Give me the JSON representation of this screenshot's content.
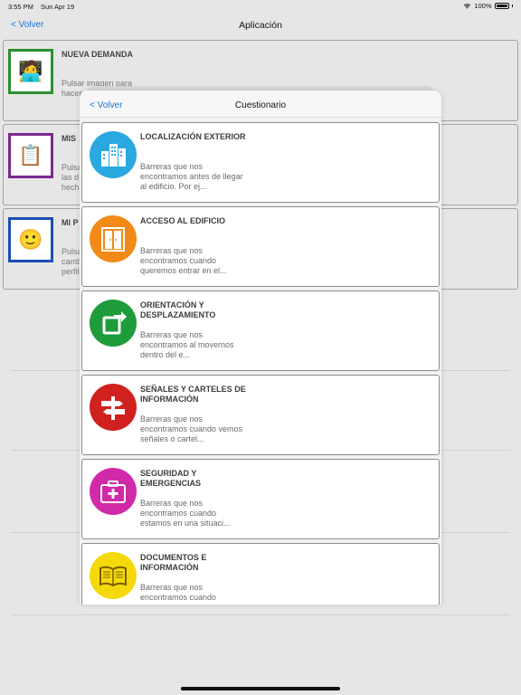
{
  "status_bar": {
    "time": "3:55 PM",
    "date": "Sun Apr 19",
    "battery": "100%"
  },
  "nav": {
    "back_label": "< Volver",
    "title": "Aplicación"
  },
  "background_cards": [
    {
      "title": "NUEVA DEMANDA",
      "desc": "Pulsar imagen para hacer"
    },
    {
      "title": "MIS",
      "desc": "Pulsa las d hech"
    },
    {
      "title": "MI P",
      "desc": "Pulsa camb perfil"
    }
  ],
  "modal": {
    "back_label": "< Volver",
    "title": "Cuestionario",
    "items": [
      {
        "name": "LOCALIZACIÓN EXTERIOR",
        "desc": "Barreras que nos encontramos antes de llegar al edificio. Por ej...",
        "color": "#2aa9e0",
        "icon": "buildings-icon"
      },
      {
        "name": "ACCESO AL EDIFICIO",
        "desc": "Barreras que nos encontramos cuando queremos entrar en el...",
        "color": "#f18a16",
        "icon": "door-icon"
      },
      {
        "name": "ORIENTACIÓN Y DESPLAZAMIENTO",
        "desc": "Barreras que nos encontramos al movernos dentro del e...",
        "color": "#1e9b3b",
        "icon": "direction-icon"
      },
      {
        "name": "SEÑALES Y CARTELES DE INFORMACIÓN",
        "desc": "Barreras que nos encontramos cuando vemos señales o cartel...",
        "color": "#d1211f",
        "icon": "signpost-icon"
      },
      {
        "name": "SEGURIDAD Y EMERGENCIAS",
        "desc": "Barreras que nos encontramos cuando estamos en una situaci...",
        "color": "#d12aa8",
        "icon": "first-aid-icon"
      },
      {
        "name": "DOCUMENTOS E INFORMACIÓN",
        "desc": "Barreras que nos encontramos cuando",
        "color": "#f5d90c",
        "icon": "book-icon"
      }
    ]
  }
}
